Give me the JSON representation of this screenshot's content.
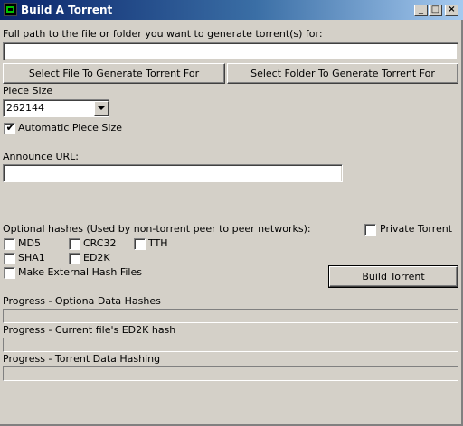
{
  "window": {
    "title": "Build A Torrent",
    "icon": "torrent-app-icon",
    "controls": {
      "minimize": "_",
      "maximize": "□",
      "close": "×"
    }
  },
  "path": {
    "label": "Full path to the file or folder you want to generate torrent(s) for:",
    "value": ""
  },
  "buttons": {
    "select_file": "Select File To Generate Torrent For",
    "select_folder": "Select Folder To Generate Torrent For",
    "build": "Build Torrent"
  },
  "piece_size": {
    "label": "Piece Size",
    "value": "262144",
    "automatic_label": "Automatic Piece Size",
    "automatic_checked": true
  },
  "announce": {
    "label": "Announce URL:",
    "value": ""
  },
  "hashes": {
    "label": "Optional hashes (Used by non-torrent peer to peer networks):",
    "md5": "MD5",
    "crc32": "CRC32",
    "tth": "TTH",
    "sha1": "SHA1",
    "ed2k": "ED2K",
    "external": "Make External Hash Files"
  },
  "private": {
    "label": "Private Torrent",
    "checked": false
  },
  "progress": {
    "optional_label": "Progress - Optiona Data Hashes",
    "optional_value": 0,
    "ed2k_label": "Progress - Current file's ED2K hash",
    "ed2k_value": 0,
    "torrent_label": "Progress - Torrent Data Hashing",
    "torrent_value": 0
  },
  "colors": {
    "window_bg": "#d4d0c8",
    "title_start": "#0a246a",
    "title_end": "#a6caf0"
  }
}
